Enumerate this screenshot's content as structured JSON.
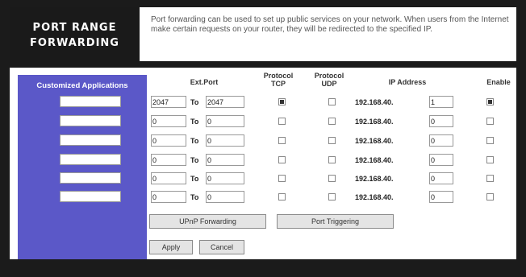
{
  "header": {
    "title_line1": "PORT RANGE",
    "title_line2": "FORWARDING",
    "description": "Port forwarding can be used to set up public services on your network. When users from the Internet make certain requests on your router, they will be redirected to the specified IP."
  },
  "sidebar": {
    "heading": "Customized Applications"
  },
  "columns": {
    "ext_port": "Ext.Port",
    "protocol_tcp": [
      "Protocol",
      "TCP"
    ],
    "protocol_udp": [
      "Protocol",
      "UDP"
    ],
    "ip_address": "IP Address",
    "enable": "Enable"
  },
  "to_label": "To",
  "ip_prefix": "192.168.40.",
  "rows": [
    {
      "app": "",
      "start": "2047",
      "end": "2047",
      "tcp": true,
      "udp": false,
      "ip": "1",
      "enabled": true
    },
    {
      "app": "",
      "start": "0",
      "end": "0",
      "tcp": false,
      "udp": false,
      "ip": "0",
      "enabled": false
    },
    {
      "app": "",
      "start": "0",
      "end": "0",
      "tcp": false,
      "udp": false,
      "ip": "0",
      "enabled": false
    },
    {
      "app": "",
      "start": "0",
      "end": "0",
      "tcp": false,
      "udp": false,
      "ip": "0",
      "enabled": false
    },
    {
      "app": "",
      "start": "0",
      "end": "0",
      "tcp": false,
      "udp": false,
      "ip": "0",
      "enabled": false
    },
    {
      "app": "",
      "start": "0",
      "end": "0",
      "tcp": false,
      "udp": false,
      "ip": "0",
      "enabled": false
    }
  ],
  "buttons": {
    "upnp": "UPnP Forwarding",
    "port_triggering": "Port Triggering",
    "apply": "Apply",
    "cancel": "Cancel"
  }
}
